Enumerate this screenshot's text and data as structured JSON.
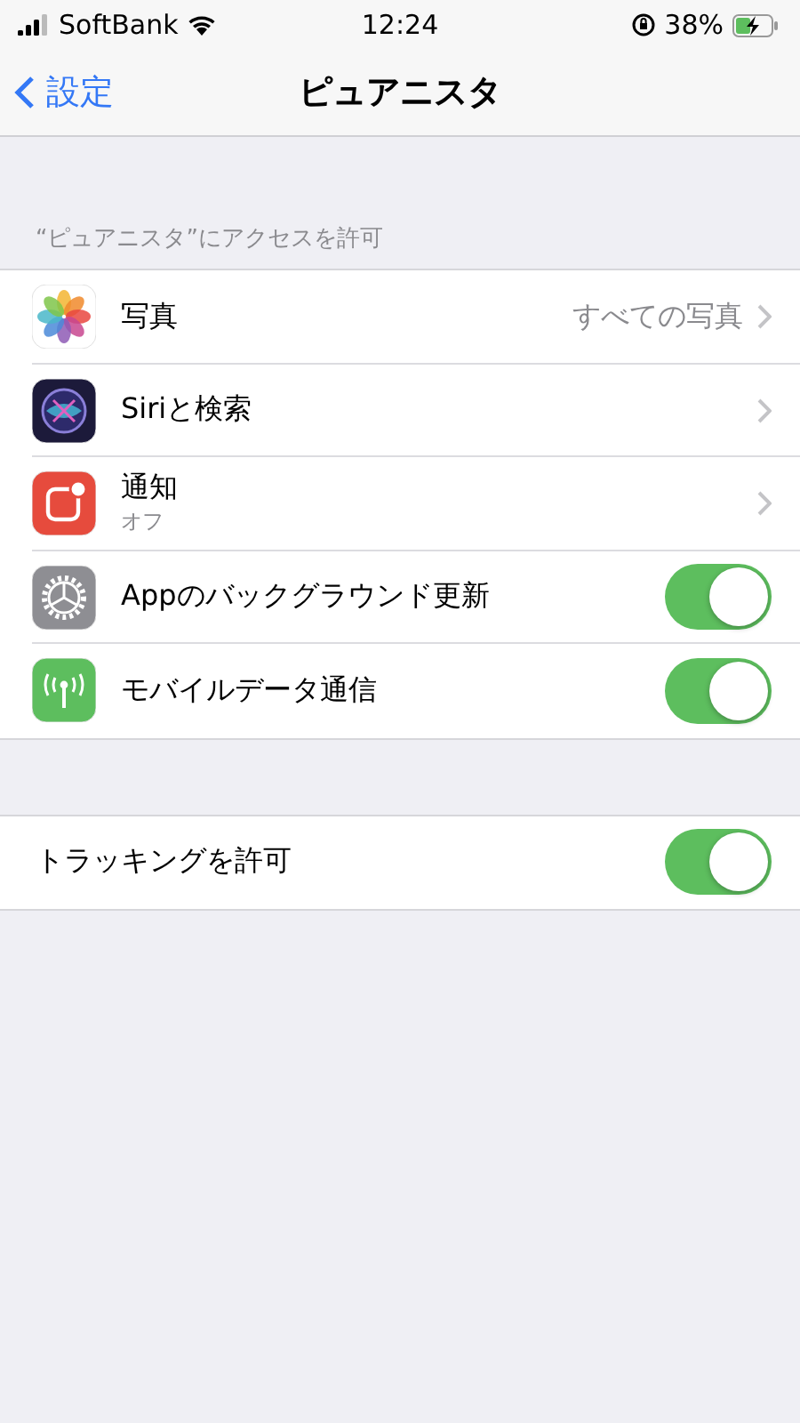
{
  "status_bar": {
    "carrier": "SoftBank",
    "time": "12:24",
    "battery": "38%"
  },
  "nav": {
    "back": "設定",
    "title": "ピュアニスタ"
  },
  "sections": [
    {
      "header": "“ピュアニスタ”にアクセスを許可",
      "rows": [
        {
          "kind": "link",
          "label": "写真",
          "value": "すべての写真"
        },
        {
          "kind": "link",
          "label": "Siriと検索"
        },
        {
          "kind": "link",
          "label": "通知",
          "subtitle": "オフ"
        },
        {
          "kind": "toggle",
          "label": "Appのバックグラウンド更新",
          "on": true
        },
        {
          "kind": "toggle",
          "label": "モバイルデータ通信",
          "on": true
        }
      ]
    },
    {
      "rows": [
        {
          "kind": "toggle",
          "label": "トラッキングを許可",
          "on": true
        }
      ]
    }
  ]
}
